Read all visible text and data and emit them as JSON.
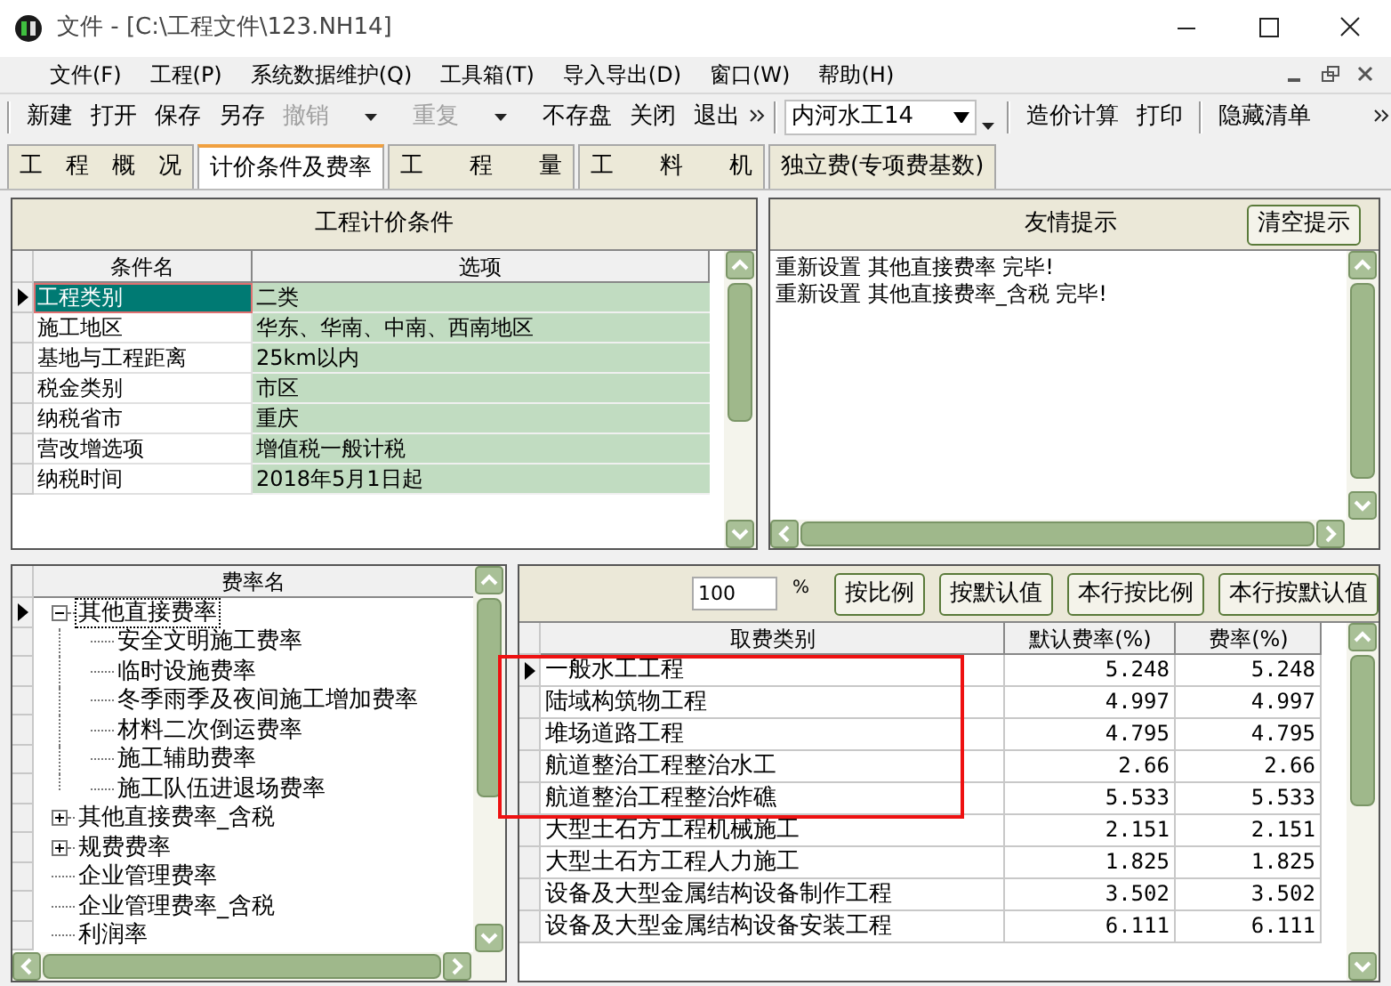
{
  "window": {
    "title": "文件 - [C:\\工程文件\\123.NH14]"
  },
  "menu": [
    "文件(F)",
    "工程(P)",
    "系统数据维护(Q)",
    "工具箱(T)",
    "导入导出(D)",
    "窗口(W)",
    "帮助(H)"
  ],
  "toolbar": [
    {
      "label": "新建",
      "disabled": false,
      "has_menu": false
    },
    {
      "label": "打开",
      "disabled": false,
      "has_menu": false
    },
    {
      "label": "保存",
      "disabled": false,
      "has_menu": false
    },
    {
      "label": "另存",
      "disabled": false,
      "has_menu": false
    },
    {
      "label": "撤销",
      "disabled": true,
      "has_menu": true
    },
    {
      "label": "重复",
      "disabled": true,
      "has_menu": true
    },
    {
      "label": "不存盘",
      "disabled": false,
      "has_menu": false
    },
    {
      "label": "关闭",
      "disabled": false,
      "has_menu": false
    },
    {
      "label": "退出",
      "disabled": false,
      "has_menu": false
    }
  ],
  "project_select": {
    "value": "内河水工14"
  },
  "toolbar_2": [
    "造价计算",
    "打印"
  ],
  "toolbar_3": [
    "隐藏清单"
  ],
  "tabs": [
    {
      "label": "工　程　概　况",
      "selected": false
    },
    {
      "label": "计价条件及费率",
      "selected": true
    },
    {
      "label": "工　　程　　量",
      "selected": false
    },
    {
      "label": "工　　料　　机",
      "selected": false
    },
    {
      "label": "独立费(专项费基数)",
      "selected": false
    }
  ],
  "conditions": {
    "title": "工程计价条件",
    "columns": [
      "条件名",
      "选项"
    ],
    "rows": [
      {
        "name": "工程类别",
        "value": "二类",
        "selected": true
      },
      {
        "name": "施工地区",
        "value": "华东、华南、中南、西南地区",
        "selected": false
      },
      {
        "name": "基地与工程距离",
        "value": "25km以内",
        "selected": false
      },
      {
        "name": "税金类别",
        "value": "市区",
        "selected": false
      },
      {
        "name": "纳税省市",
        "value": "重庆",
        "selected": false
      },
      {
        "name": "营改增选项",
        "value": "增值税一般计税",
        "selected": false
      },
      {
        "name": "纳税时间",
        "value": "2018年5月1日起",
        "selected": false
      }
    ]
  },
  "tips": {
    "title": "友情提示",
    "clear_button": "清空提示",
    "lines": [
      "重新设置 其他直接费率 完毕!",
      "重新设置 其他直接费率_含税 完毕!"
    ]
  },
  "rate_tree": {
    "column": "费率名",
    "items": [
      {
        "label": "其他直接费率",
        "kind": "group",
        "expanded": true,
        "selected": true,
        "children": [
          {
            "label": "安全文明施工费率",
            "kind": "leaf",
            "selected": false
          },
          {
            "label": "临时设施费率",
            "kind": "leaf",
            "selected": false
          },
          {
            "label": "冬季雨季及夜间施工增加费率",
            "kind": "leaf",
            "selected": false
          },
          {
            "label": "材料二次倒运费率",
            "kind": "leaf",
            "selected": false
          },
          {
            "label": "施工辅助费率",
            "kind": "leaf",
            "selected": false
          },
          {
            "label": "施工队伍进退场费率",
            "kind": "leaf",
            "selected": false
          }
        ]
      },
      {
        "label": "其他直接费率_含税",
        "kind": "group",
        "expanded": false,
        "selected": false
      },
      {
        "label": "规费费率",
        "kind": "group",
        "expanded": false,
        "selected": false
      },
      {
        "label": "企业管理费率",
        "kind": "leaf",
        "selected": false
      },
      {
        "label": "企业管理费率_含税",
        "kind": "leaf",
        "selected": false
      },
      {
        "label": "利润率",
        "kind": "leaf",
        "selected": false
      }
    ]
  },
  "rates": {
    "percent_value": "100",
    "percent_unit": "%",
    "buttons": [
      "按比例",
      "按默认值",
      "本行按比例",
      "本行按默认值"
    ],
    "columns": [
      "取费类别",
      "默认费率(%)",
      "费率(%)"
    ],
    "rows": [
      {
        "category": "一般水工工程",
        "default": "5.248",
        "rate": "5.248",
        "selected": true
      },
      {
        "category": "陆域构筑物工程",
        "default": "4.997",
        "rate": "4.997",
        "selected": false
      },
      {
        "category": "堆场道路工程",
        "default": "4.795",
        "rate": "4.795",
        "selected": false
      },
      {
        "category": "航道整治工程整治水工",
        "default": "2.66",
        "rate": "2.66",
        "selected": false
      },
      {
        "category": "航道整治工程整治炸礁",
        "default": "5.533",
        "rate": "5.533",
        "selected": false
      },
      {
        "category": "大型土石方工程机械施工",
        "default": "2.151",
        "rate": "2.151",
        "selected": false
      },
      {
        "category": "大型土石方工程人力施工",
        "default": "1.825",
        "rate": "1.825",
        "selected": false
      },
      {
        "category": "设备及大型金属结构设备制作工程",
        "default": "3.502",
        "rate": "3.502",
        "selected": false
      },
      {
        "category": "设备及大型金属结构设备安装工程",
        "default": "6.111",
        "rate": "6.111",
        "selected": false
      }
    ]
  }
}
